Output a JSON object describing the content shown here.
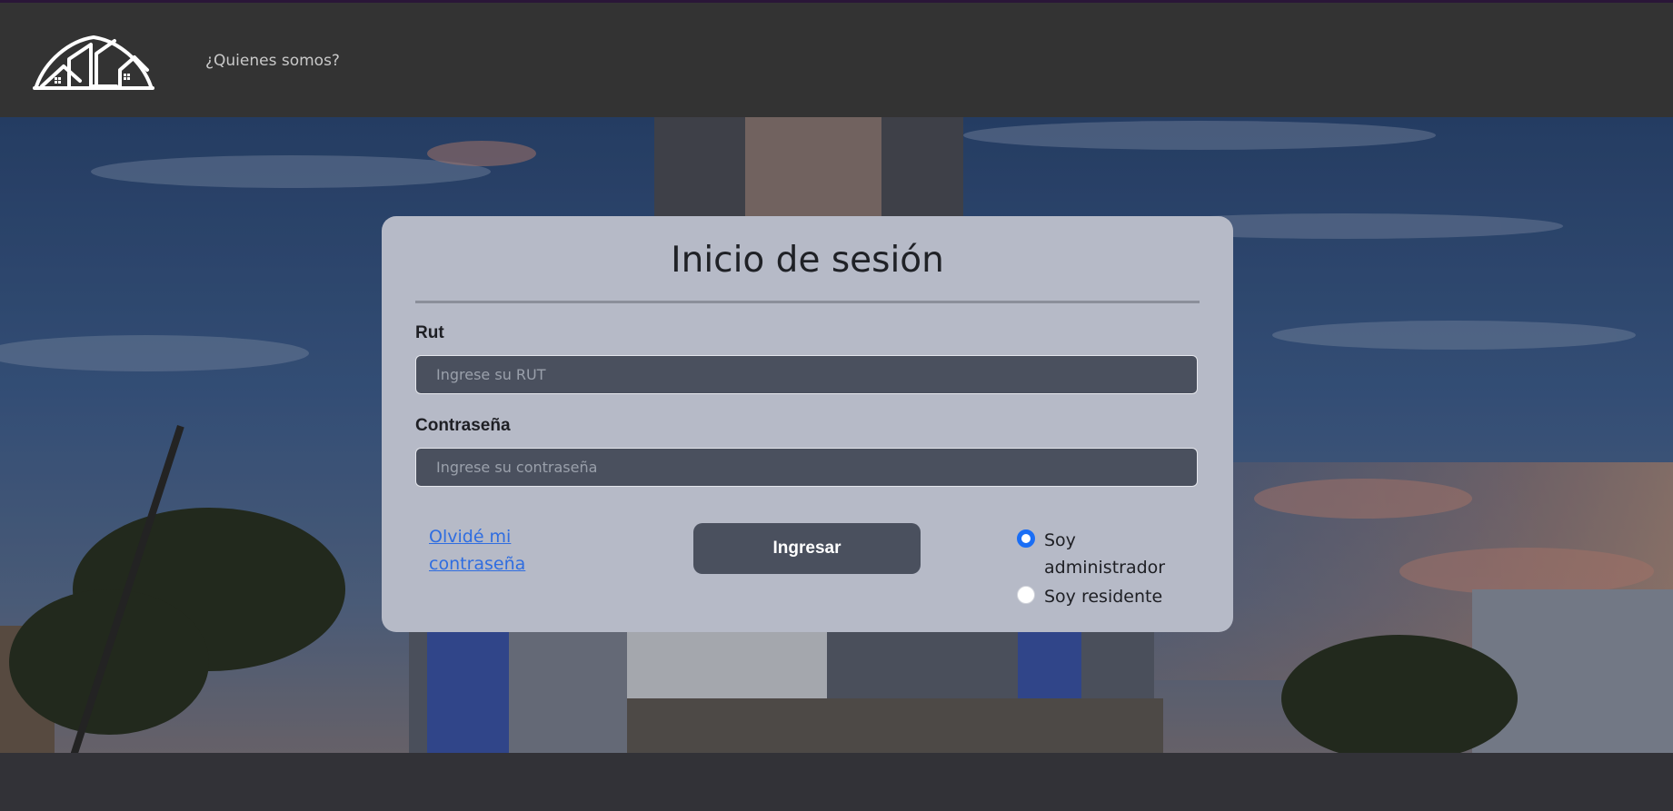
{
  "navbar": {
    "logo_alt": "house-roof logo",
    "link_about": "¿Quienes somos?"
  },
  "login": {
    "title": "Inicio de sesión",
    "rut_label": "Rut",
    "rut_placeholder": "Ingrese su RUT",
    "rut_value": "",
    "password_label": "Contraseña",
    "password_placeholder": "Ingrese su contraseña",
    "password_value": "",
    "forgot_link": "Olvidé mi contraseña",
    "submit_label": "Ingresar",
    "role_options": [
      {
        "label": "Soy administrador",
        "selected": true
      },
      {
        "label": "Soy residente",
        "selected": false
      }
    ]
  },
  "colors": {
    "navbar_bg": "#333333",
    "card_bg": "#b6bac7",
    "input_bg": "#4a505e",
    "button_bg": "#4a505e",
    "link": "#2f6de0",
    "radio_accent": "#1a6ef5"
  }
}
